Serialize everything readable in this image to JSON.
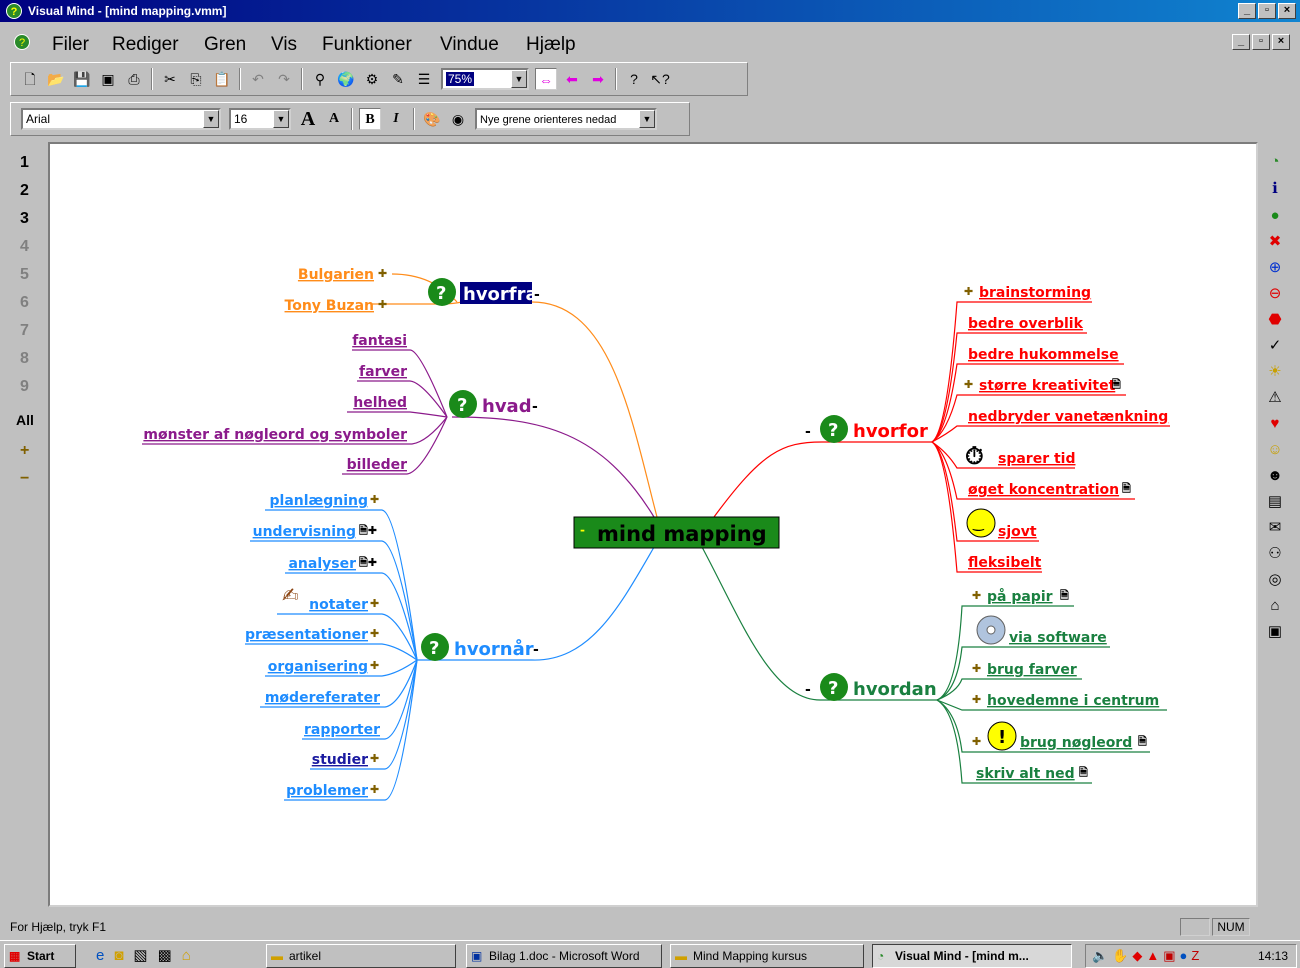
{
  "window": {
    "title": "Visual Mind - [mind mapping.vmm]"
  },
  "menu": [
    "Filer",
    "Rediger",
    "Gren",
    "Vis",
    "Funktioner",
    "Vindue",
    "Hjælp"
  ],
  "toolbar": {
    "zoom": "75%"
  },
  "formatbar": {
    "font": "Arial",
    "size": "16",
    "bold": "B",
    "italic": "I",
    "orientation": "Nye grene orienteres nedad"
  },
  "levels": [
    "1",
    "2",
    "3",
    "4",
    "5",
    "6",
    "7",
    "8",
    "9",
    "All",
    "+",
    "−"
  ],
  "map": {
    "center": "mind mapping",
    "branches": {
      "hvorfra": {
        "label": "hvorfra",
        "color": "#ff8c1a",
        "items": [
          "Bulgarien",
          "Tony Buzan"
        ]
      },
      "hvad": {
        "label": "hvad",
        "color": "#8b1a8b",
        "items": [
          "fantasi",
          "farver",
          "helhed",
          "mønster af nøgleord og symboler",
          "billeder"
        ]
      },
      "hvornaar": {
        "label": "hvornår",
        "color": "#1e8cff",
        "items": [
          "planlægning",
          "undervisning",
          "analyser",
          "notater",
          "præsentationer",
          "organisering",
          "mødereferater",
          "rapporter",
          "studier",
          "problemer"
        ]
      },
      "hvorfor": {
        "label": "hvorfor",
        "color": "#ff0000",
        "items": [
          "brainstorming",
          "bedre overblik",
          "bedre hukommelse",
          "større kreativitet",
          "nedbryder vanetænkning",
          "sparer tid",
          "øget koncentration",
          "sjovt",
          "fleksibelt"
        ]
      },
      "hvordan": {
        "label": "hvordan",
        "color": "#1a8040",
        "items": [
          "på papir",
          "via software",
          "brug farver",
          "hovedemne i centrum",
          "brug nøgleord",
          "skriv alt ned"
        ]
      }
    }
  },
  "status": {
    "help": "For Hjælp, tryk F1",
    "num": "NUM"
  },
  "taskbar": {
    "start": "Start",
    "items": [
      "artikel",
      "Bilag 1.doc - Microsoft Word",
      "Mind Mapping kursus",
      "Visual Mind - [mind m..."
    ],
    "clock": "14:13"
  }
}
